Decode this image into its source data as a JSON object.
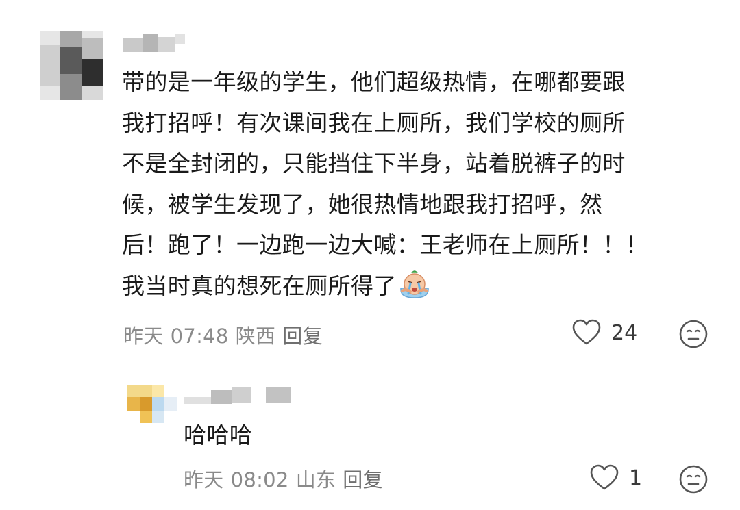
{
  "comments": [
    {
      "text_lines": [
        "带的是一年级的学生，他们超级热情，在哪都要跟",
        "我打招呼！有次课间我在上厕所，我们学校的厕所",
        "不是全封闭的，只能挡住下半身，站着脱裤子的时",
        "候，被学生发现了，她很热情地跟我打招呼，然",
        "后！跑了！一边跑一边大喊：王老师在上厕所！！！",
        "我当时真的想死在厕所得了"
      ],
      "emoji": "crying-emoji",
      "date": "昨天",
      "time": "07:48",
      "location": "陕西",
      "reply_label": "回复",
      "like_count": "24"
    },
    {
      "text_lines": [
        "哈哈哈"
      ],
      "date": "昨天",
      "time": "08:02",
      "location": "山东",
      "reply_label": "回复",
      "like_count": "1"
    }
  ],
  "colors": {
    "text": "#1a1a1a",
    "meta": "#8a8a8a",
    "icon_stroke": "#555555"
  }
}
